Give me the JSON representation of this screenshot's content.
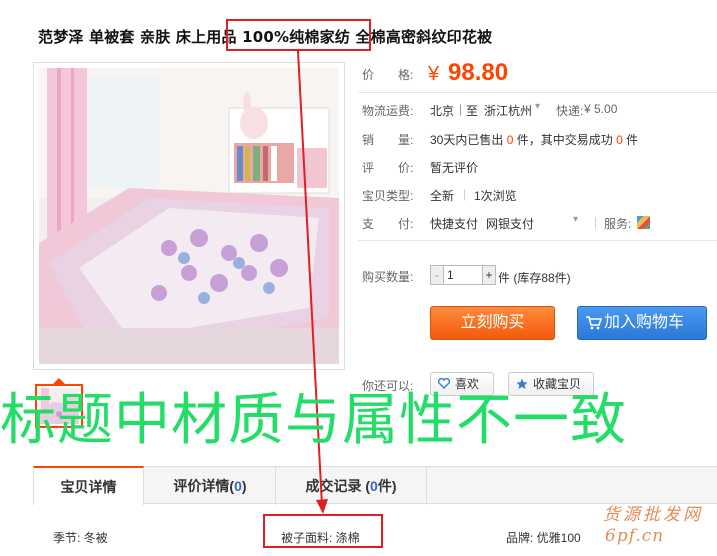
{
  "product": {
    "title": "范梦泽 单被套 亲肤 床上用品 100%纯棉家纺 全棉高密斜纹印花被",
    "price_label": "价　　格:",
    "price_currency": "¥",
    "price": "98.80",
    "shipping_label": "物流运费:",
    "shipping_from": "北京",
    "shipping_sep": "至",
    "shipping_to": "浙江杭州",
    "shipping_method": "快递:",
    "shipping_cost": "¥ 5.00",
    "sales_label": "销　　量:",
    "sales_prefix": "30天内已售出",
    "sales_count": "0",
    "sales_mid": "件，其中交易成功",
    "sales_success": "0",
    "sales_suffix": "件",
    "rating_label": "评　　价:",
    "rating_value": "暂无评价",
    "type_label": "宝贝类型:",
    "type_value": "全新",
    "views": "1次浏览",
    "pay_label": "支　　付:",
    "pay_quick": "快捷支付",
    "pay_bank": "网银支付",
    "service_label": "服务:",
    "qty_label": "购买数量:",
    "qty_minus": "-",
    "qty_value": "1",
    "qty_plus": "+",
    "qty_suffix": "件 (库存88件)",
    "buy_now": "立刻购买",
    "add_cart": "加入购物车",
    "also_label": "你还可以:",
    "like_btn": "喜欢",
    "fav_btn": "收藏宝贝"
  },
  "annotation": {
    "overlay_text": "标题中材质与属性不一致",
    "highlight_title_part": "100%纯棉家纺",
    "highlight_attr": "被子面料: 涤棉"
  },
  "tabs": [
    {
      "label": "宝贝详情",
      "count": ""
    },
    {
      "label": "评价详情(",
      "count": "0",
      "suffix": ")"
    },
    {
      "label": "成交记录 (",
      "count": "0",
      "suffix": "件)"
    }
  ],
  "attributes": {
    "season": "季节: 冬被",
    "fabric": "被子面料: 涤棉",
    "brand": "品牌: 优雅100"
  },
  "watermark": {
    "line1": "货源批发网",
    "line2": "6pf.cn"
  },
  "colors": {
    "accent": "#ff4400",
    "overlay_green": "#22dd66",
    "highlight_red": "#e02020",
    "cart_blue": "#2a78d8"
  }
}
